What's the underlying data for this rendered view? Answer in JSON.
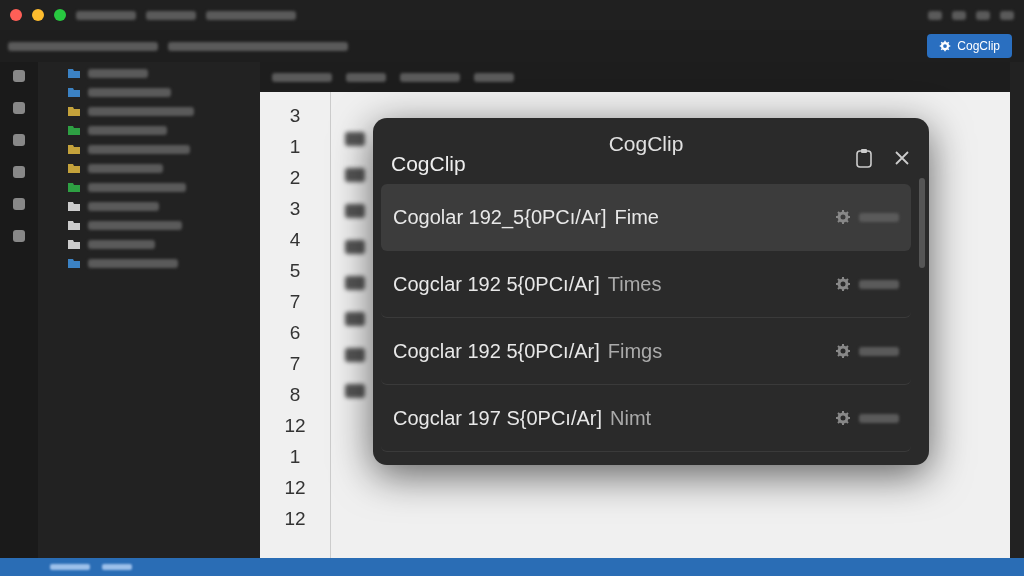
{
  "toolbar": {
    "button": "CogClip"
  },
  "editor": {
    "line_numbers": [
      "3",
      "1",
      "2",
      "3",
      "4",
      "5",
      "7",
      "6",
      "7",
      "8",
      "12",
      "1",
      "12",
      "12"
    ]
  },
  "popup": {
    "title": "CogClip",
    "header": "CogClip",
    "items": [
      {
        "text": "Cogolar 192_5{0PCı/Ar]",
        "suffix": "Fime",
        "selected": true
      },
      {
        "text": "Cogclar 192 5{0PCı/Ar]",
        "suffix": "Times",
        "selected": false
      },
      {
        "text": "Cogclar 192 5{0PCı/Ar]",
        "suffix": "Fimgs",
        "selected": false
      },
      {
        "text": "Cogclar 197 S{0PCı/Ar]",
        "suffix": "Nimt",
        "selected": false
      }
    ]
  }
}
